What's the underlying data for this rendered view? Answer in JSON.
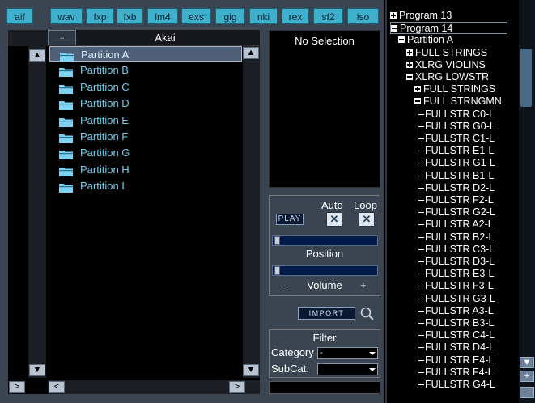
{
  "tabs": [
    "aif",
    "wav",
    "fxp",
    "fxb",
    "lm4",
    "exs",
    "gig",
    "nki",
    "rex",
    "sf2",
    "iso"
  ],
  "list": {
    "up_label": "..",
    "title": "Akai",
    "items": [
      "Partition A",
      "Partition B",
      "Partition C",
      "Partition D",
      "Partition E",
      "Partition F",
      "Partition G",
      "Partition H",
      "Partition I"
    ],
    "selected_index": 0
  },
  "preview": {
    "status": "No Selection"
  },
  "player": {
    "auto_label": "Auto",
    "loop_label": "Loop",
    "play_label": "PLAY",
    "position_label": "Position",
    "volume_minus": "-",
    "volume_label": "Volume",
    "volume_plus": "+",
    "checked_glyph": "✕"
  },
  "import": {
    "label": "IMPORT"
  },
  "filter": {
    "title": "Filter",
    "category_label": "Category",
    "category_value": "-",
    "subcat_label": "SubCat.",
    "subcat_value": ""
  },
  "scroll": {
    "up": "▲",
    "down": "▼",
    "left": "<",
    "right": ">"
  },
  "tree": {
    "nodes": [
      {
        "label": "Program 13",
        "toggle": "plus"
      },
      {
        "label": "Program 14",
        "toggle": "minus",
        "selected": true
      },
      {
        "label": "Partition A",
        "toggle": "minus"
      },
      {
        "label": "FULL STRINGS",
        "toggle": "plus"
      },
      {
        "label": "XLRG VIOLINS",
        "toggle": "plus"
      },
      {
        "label": "XLRG LOWSTR",
        "toggle": "minus"
      },
      {
        "label": "FULL STRINGS",
        "toggle": "plus"
      },
      {
        "label": "FULL STRNGMN",
        "toggle": "minus"
      }
    ],
    "leaves": [
      "FULLSTR C0-L",
      "FULLSTR G0-L",
      "FULLSTR C1-L",
      "FULLSTR E1-L",
      "FULLSTR G1-L",
      "FULLSTR B1-L",
      "FULLSTR D2-L",
      "FULLSTR F2-L",
      "FULLSTR G2-L",
      "FULLSTR A2-L",
      "FULLSTR B2-L",
      "FULLSTR C3-L",
      "FULLSTR D3-L",
      "FULLSTR E3-L",
      "FULLSTR F3-L",
      "FULLSTR G3-L",
      "FULLSTR A3-L",
      "FULLSTR B3-L",
      "FULLSTR C4-L",
      "FULLSTR D4-L",
      "FULLSTR E4-L",
      "FULLSTR F4-L",
      "FULLSTR G4-L"
    ],
    "plus_btn": "+",
    "minus_btn": "−"
  },
  "colors": {
    "tab_bg": "#3fb0cc",
    "list_text": "#6ed0ef",
    "panel_bg": "#3b4552",
    "selection_bg": "#4f5f78"
  }
}
